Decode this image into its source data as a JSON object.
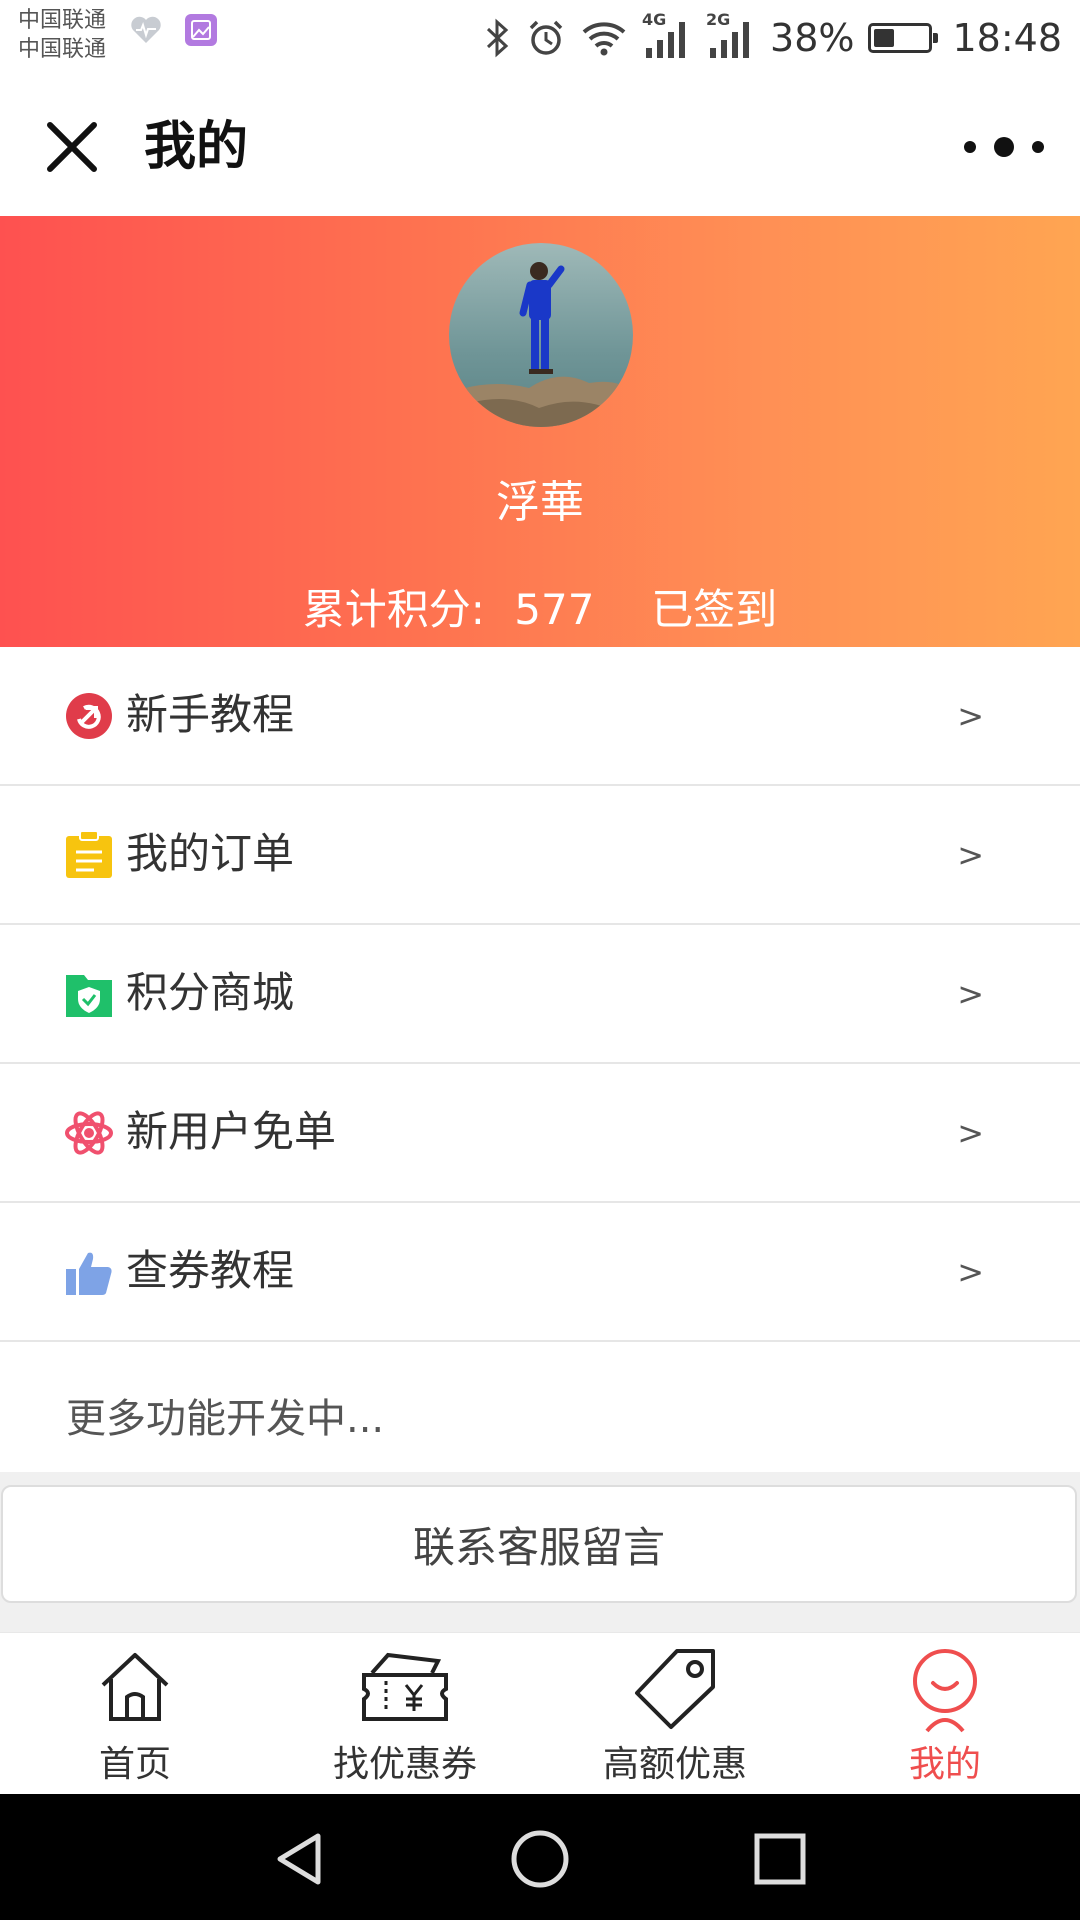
{
  "status_bar": {
    "carrier1": "中国联通",
    "carrier2": "中国联通",
    "network1": "4G",
    "network2": "2G",
    "battery": "38%",
    "time": "18:48"
  },
  "title_bar": {
    "title": "我的"
  },
  "profile": {
    "nickname": "浮華",
    "points_label": "累计积分:",
    "points_value": "577",
    "checkin_status": "已签到"
  },
  "menu": {
    "items": [
      {
        "label": "新手教程",
        "icon": "tutorial-icon",
        "color": "#e03c4a",
        "arrow": ">"
      },
      {
        "label": "我的订单",
        "icon": "clipboard-icon",
        "color": "#f7c40f",
        "arrow": ">"
      },
      {
        "label": "积分商城",
        "icon": "shield-check-folder-icon",
        "color": "#1fc06a",
        "arrow": ">"
      },
      {
        "label": "新用户免单",
        "icon": "atom-icon",
        "color": "#f0506e",
        "arrow": ">"
      },
      {
        "label": "查券教程",
        "icon": "thumbs-up-icon",
        "color": "#7ea3e6",
        "arrow": ">"
      }
    ],
    "more_text": "更多功能开发中..."
  },
  "contact_button": "联系客服留言",
  "tabs": [
    {
      "label": "首页",
      "icon": "home-icon"
    },
    {
      "label": "找优惠券",
      "icon": "coupon-icon"
    },
    {
      "label": "高额优惠",
      "icon": "tag-icon"
    },
    {
      "label": "我的",
      "icon": "user-icon",
      "active": true
    }
  ],
  "colors": {
    "gradient_start": "#fe5150",
    "gradient_end": "#ffa552",
    "active_tab": "#ef4e4e"
  }
}
